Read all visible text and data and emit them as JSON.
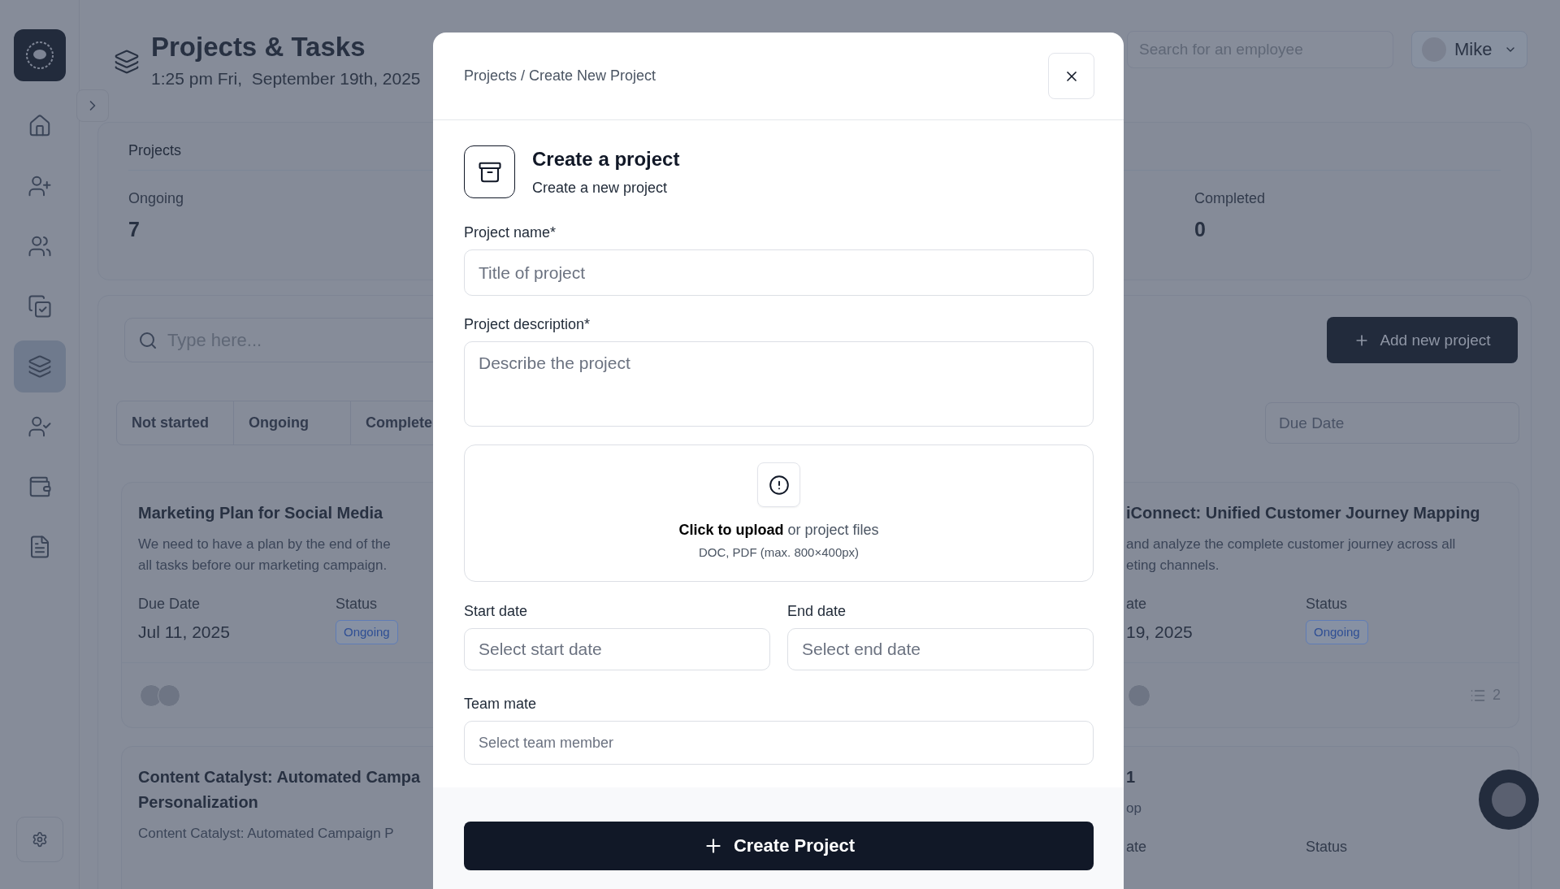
{
  "sidebar": {
    "nav": [
      {
        "kind": "home",
        "selected": false
      },
      {
        "kind": "user-in",
        "selected": false
      },
      {
        "kind": "users",
        "selected": false
      },
      {
        "kind": "tasks",
        "selected": false
      },
      {
        "kind": "projects",
        "selected": true
      },
      {
        "kind": "user-check",
        "selected": false
      },
      {
        "kind": "wallet",
        "selected": false
      },
      {
        "kind": "reports",
        "selected": false
      }
    ]
  },
  "header": {
    "title": "Projects & Tasks",
    "datetime": "1:25 pm Fri,  September 19th, 2025"
  },
  "employee_search": {
    "placeholder": "Search for an employee"
  },
  "user_menu": {
    "name": "Mike"
  },
  "stats": {
    "title": "Projects",
    "items": [
      {
        "label": "Ongoing",
        "value": "7"
      },
      {
        "label": "Completed",
        "value": "0"
      }
    ]
  },
  "projects_panel": {
    "search": {
      "placeholder": "Type here..."
    },
    "add_button": "Add new project",
    "tabs": [
      {
        "label": "Not started"
      },
      {
        "label": "Ongoing"
      },
      {
        "label": "Complete"
      }
    ],
    "due_date_filter": {
      "placeholder": "Due Date"
    }
  },
  "left_cards": [
    {
      "title_lines": [
        "Marketing Plan for Social Media"
      ],
      "description_lines": [
        "We need to have a plan by the end of the",
        "all tasks before our marketing campaign."
      ],
      "due_label": "Due Date",
      "due_value": "Jul 11, 2025",
      "status_label": "Status",
      "status": "Ongoing",
      "avatars": [
        {
          "kind": "photo"
        },
        {
          "kind": "photo"
        }
      ]
    },
    {
      "title_lines": [
        "Content Catalyst: Automated Campa",
        "Personalization"
      ],
      "description_lines": [
        "Content Catalyst: Automated Campaign P"
      ]
    }
  ],
  "right_cards": [
    {
      "title_lines": [
        "iConnect: Unified Customer Journey Mapping"
      ],
      "description_lines": [
        "and analyze the complete customer journey across all",
        "eting channels."
      ],
      "due_label": "ate",
      "due_value": "19, 2025",
      "status_label": "Status",
      "status": "Ongoing",
      "avatars": [
        {
          "kind": "photo"
        }
      ],
      "task_count": "2"
    },
    {
      "title_lines": [
        "1"
      ],
      "description_lines": [
        "op"
      ],
      "due_label": "ate",
      "status_label": "Status"
    }
  ],
  "modal": {
    "breadcrumb": "Projects / Create New Project",
    "heading": "Create a project",
    "subheading": "Create a new project",
    "fields": [
      {
        "kind": "input",
        "label": "Project name*",
        "placeholder": "Title of project"
      },
      {
        "kind": "textarea",
        "label": "Project description*",
        "placeholder": "Describe the project"
      }
    ],
    "upload": {
      "text": "**Click to upload** or project files",
      "hint": "DOC, PDF (max. 800×400px)"
    },
    "date_fields": [
      {
        "label": "Start date",
        "placeholder": "Select start date"
      },
      {
        "label": "End date",
        "placeholder": "Select end date"
      }
    ],
    "team_field": {
      "label": "Team mate",
      "placeholder": "Select team member"
    },
    "submit": "Create Project"
  }
}
